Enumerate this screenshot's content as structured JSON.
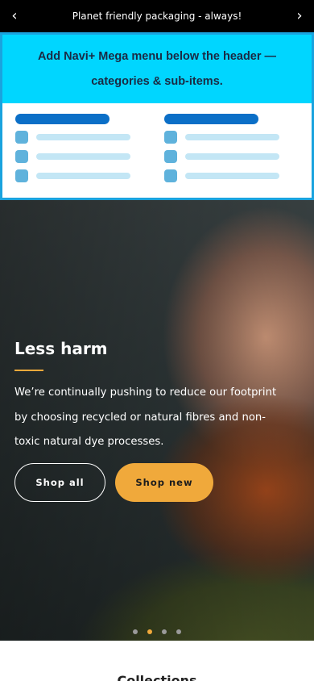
{
  "announcement": {
    "text": "Planet friendly packaging - always!",
    "prev_icon": "chevron-left-icon",
    "next_icon": "chevron-right-icon"
  },
  "mega_menu": {
    "banner_text": "Add Navi+ Mega menu below the header — categories & sub-items.",
    "colors": {
      "banner_bg": "#00d6ff",
      "border": "#1aa3de",
      "heading_bar": "#0b6fc7",
      "item_square": "#5fb2dc",
      "item_line": "#c3e6f5"
    }
  },
  "hero": {
    "title": "Less harm",
    "body": "We’re continually pushing to reduce our footprint by choosing recycled or natural fibres and non-toxic natural dye processes.",
    "buttons": {
      "shop_all": "Shop all",
      "shop_new": "Shop new"
    },
    "accent_color": "#f0a93b",
    "slides": {
      "count": 4,
      "active": 2
    }
  },
  "next_section": {
    "title": "Collections"
  }
}
